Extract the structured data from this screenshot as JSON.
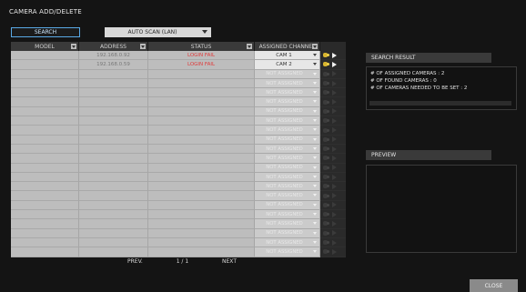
{
  "window": {
    "title": "CAMERA ADD/DELETE"
  },
  "toolbar": {
    "search_label": "SEARCH",
    "scan_mode": "AUTO SCAN (LAN)"
  },
  "table": {
    "headers": {
      "model": "MODEL",
      "address": "ADDRESS",
      "status": "STATUS",
      "channel": "ASSIGNED CHANNEL"
    },
    "rows": [
      {
        "model": "",
        "address": "192.168.0.92",
        "status": "LOGIN FAIL",
        "channel": "CAM 1",
        "assigned": true
      },
      {
        "model": "",
        "address": "192.168.0.59",
        "status": "LOGIN FAIL",
        "channel": "CAM 2",
        "assigned": true
      },
      {
        "model": "",
        "address": "",
        "status": "",
        "channel": "NOT ASSIGNED",
        "assigned": false
      },
      {
        "model": "",
        "address": "",
        "status": "",
        "channel": "NOT ASSIGNED",
        "assigned": false
      },
      {
        "model": "",
        "address": "",
        "status": "",
        "channel": "NOT ASSIGNED",
        "assigned": false
      },
      {
        "model": "",
        "address": "",
        "status": "",
        "channel": "NOT ASSIGNED",
        "assigned": false
      },
      {
        "model": "",
        "address": "",
        "status": "",
        "channel": "NOT ASSIGNED",
        "assigned": false
      },
      {
        "model": "",
        "address": "",
        "status": "",
        "channel": "NOT ASSIGNED",
        "assigned": false
      },
      {
        "model": "",
        "address": "",
        "status": "",
        "channel": "NOT ASSIGNED",
        "assigned": false
      },
      {
        "model": "",
        "address": "",
        "status": "",
        "channel": "NOT ASSIGNED",
        "assigned": false
      },
      {
        "model": "",
        "address": "",
        "status": "",
        "channel": "NOT ASSIGNED",
        "assigned": false
      },
      {
        "model": "",
        "address": "",
        "status": "",
        "channel": "NOT ASSIGNED",
        "assigned": false
      },
      {
        "model": "",
        "address": "",
        "status": "",
        "channel": "NOT ASSIGNED",
        "assigned": false
      },
      {
        "model": "",
        "address": "",
        "status": "",
        "channel": "NOT ASSIGNED",
        "assigned": false
      },
      {
        "model": "",
        "address": "",
        "status": "",
        "channel": "NOT ASSIGNED",
        "assigned": false
      },
      {
        "model": "",
        "address": "",
        "status": "",
        "channel": "NOT ASSIGNED",
        "assigned": false
      },
      {
        "model": "",
        "address": "",
        "status": "",
        "channel": "NOT ASSIGNED",
        "assigned": false
      },
      {
        "model": "",
        "address": "",
        "status": "",
        "channel": "NOT ASSIGNED",
        "assigned": false
      },
      {
        "model": "",
        "address": "",
        "status": "",
        "channel": "NOT ASSIGNED",
        "assigned": false
      },
      {
        "model": "",
        "address": "",
        "status": "",
        "channel": "NOT ASSIGNED",
        "assigned": false
      },
      {
        "model": "",
        "address": "",
        "status": "",
        "channel": "NOT ASSIGNED",
        "assigned": false
      },
      {
        "model": "",
        "address": "",
        "status": "",
        "channel": "NOT ASSIGNED",
        "assigned": false
      }
    ]
  },
  "pagination": {
    "prev_label": "PREV.",
    "page_info": "1 / 1",
    "next_label": "NEXT"
  },
  "search_result": {
    "title": "SEARCH RESULT",
    "lines": [
      "# OF ASSIGNED CAMERAS : 2",
      "# OF FOUND CAMERAS : 0",
      "# OF CAMERAS NEEDED TO BE SET : 2"
    ]
  },
  "preview": {
    "title": "PREVIEW"
  },
  "footer": {
    "close_label": "CLOSE"
  },
  "colors": {
    "status_error": "#e03a3a",
    "accent_border": "#5aa9e6",
    "camera_icon": "#d8b530"
  },
  "icons": {
    "setup": "camera-setup-icon",
    "play": "play-icon",
    "sort": "sort-icon"
  }
}
